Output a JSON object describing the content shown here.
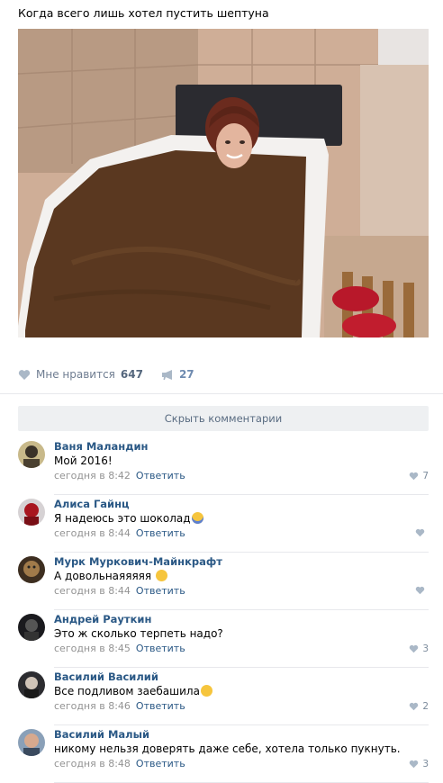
{
  "post": {
    "text": "Когда всего лишь хотел пустить шептуна"
  },
  "actions": {
    "like_label": "Мне нравится",
    "like_count": "647",
    "share_count": "27"
  },
  "hide_comments_label": "Скрыть комментарии",
  "comments": [
    {
      "author": "Ваня Маландин",
      "text": "Мой 2016!",
      "time": "сегодня в 8:42",
      "reply": "Ответить",
      "likes": "7"
    },
    {
      "author": "Алиса Гайнц",
      "text": "Я надеюсь это шоколад",
      "emoji": "scream-emoji",
      "time": "сегодня в 8:44",
      "reply": "Ответить",
      "likes": ""
    },
    {
      "author": "Мурк Муркович-Майнкрафт",
      "text": "А довольнаяяяяя",
      "emoji": "smile-emoji",
      "time": "сегодня в 8:44",
      "reply": "Ответить",
      "likes": ""
    },
    {
      "author": "Андрей Рауткин",
      "text": "Это ж сколько терпеть надо?",
      "time": "сегодня в 8:45",
      "reply": "Ответить",
      "likes": "3"
    },
    {
      "author": "Василий Василий",
      "text": "Все подливом заебашила",
      "emoji": "laugh-emoji",
      "time": "сегодня в 8:46",
      "reply": "Ответить",
      "likes": "2"
    },
    {
      "author": "Василий Малый",
      "text": "никому нельзя доверять даже себе, хотела только пукнуть.",
      "time": "сегодня в 8:48",
      "reply": "Ответить",
      "likes": "3"
    }
  ],
  "colors": {
    "link": "#2a5885",
    "meta": "#939393",
    "button_bg": "#eef0f2"
  }
}
